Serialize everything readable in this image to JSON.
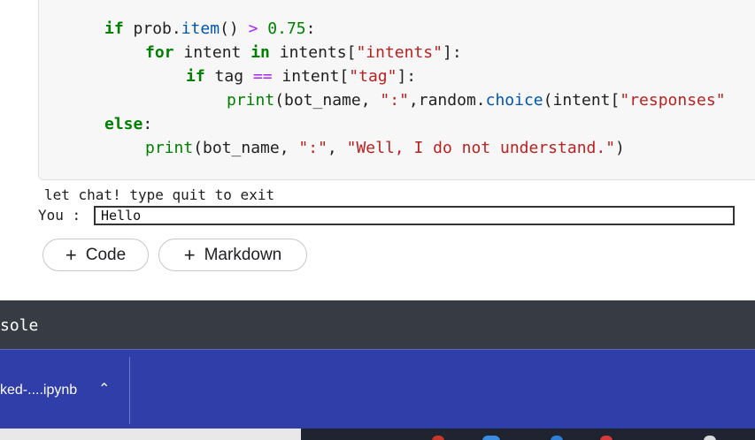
{
  "code": {
    "line1": {
      "kw": "if",
      "a": " prob.",
      "fn": "item",
      "b": "() ",
      "op": ">",
      "c": " ",
      "num": "0.75",
      "d": ":"
    },
    "line2": {
      "kw1": "for",
      "a": " intent ",
      "kw2": "in",
      "b": " intents[",
      "str": "\"intents\"",
      "c": "]:"
    },
    "line3": {
      "kw": "if",
      "a": " tag ",
      "op": "==",
      "b": " intent[",
      "str": "\"tag\"",
      "c": "]:"
    },
    "line4": {
      "bi": "print",
      "a": "(bot_name, ",
      "str1": "\":\"",
      "b": ",random.",
      "fn": "choice",
      "c": "(intent[",
      "str2": "\"responses\""
    },
    "line5": {
      "kw": "else",
      "a": ":"
    },
    "line6": {
      "bi": "print",
      "a": "(bot_name, ",
      "str1": "\":\"",
      "b": ", ",
      "str2": "\"Well, I do not understand.\"",
      "c": ")"
    }
  },
  "output": {
    "line1": "let chat! type quit to exit",
    "prompt": "You :",
    "input_value": "Hello"
  },
  "add_buttons": {
    "code_label": "Code",
    "markdown_label": "Markdown"
  },
  "console": {
    "label": "sole"
  },
  "download": {
    "file_name": "ked-....ipynb"
  },
  "icons": {
    "plus": "plus-icon",
    "chevron": "chevron-up-icon"
  }
}
